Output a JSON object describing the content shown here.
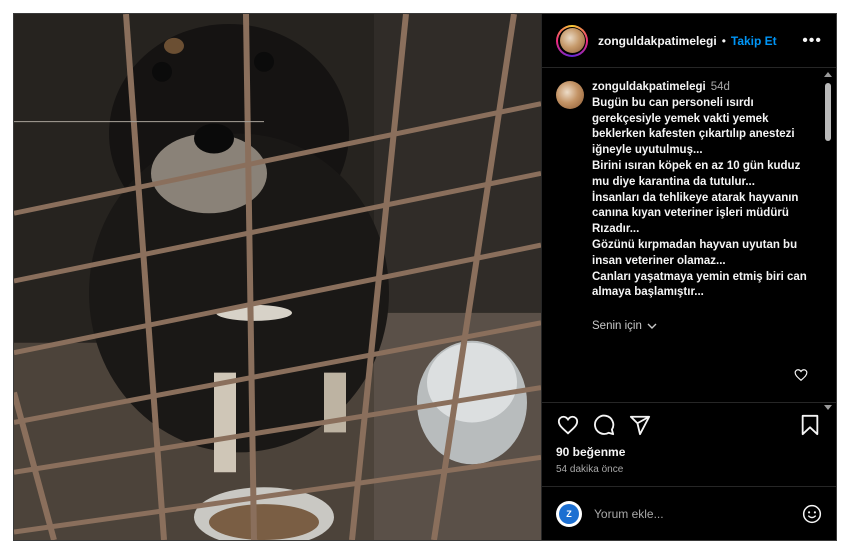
{
  "post": {
    "photo_alt": "",
    "header": {
      "username": "zonguldakpatimelegi",
      "separator": "•",
      "follow_label": "Takip Et",
      "more_label": "•••"
    },
    "caption": {
      "username": "zonguldakpatimelegi",
      "time": "54d",
      "lines": [
        "Bugün bu can personeli ısırdı",
        "gerekçesiyle yemek vakti yemek",
        "beklerken kafesten çıkartılıp anestezi",
        "iğneyle uyutulmuş...",
        "Birini ısıran köpek en az 10 gün kuduz",
        "mu diye karantina da tutulur...",
        "İnsanları da tehlikeye atarak hayvanın",
        "canına kıyan veteriner işleri müdürü",
        "Rızadır...",
        "Gözünü kırpmadan hayvan uyutan bu",
        "insan veteriner olamaz...",
        "Canları yaşatmaya yemin etmiş biri can",
        "almaya başlamıştır..."
      ],
      "translation_label": "Senin için"
    },
    "engagement": {
      "likes": "90 beğenme",
      "time_ago": "54 dakika önce"
    },
    "comment": {
      "placeholder": "Yorum ekle...",
      "avatar_label": "Z"
    }
  },
  "colors": {
    "accent": "#0095f6",
    "background": "#000000",
    "text": "#f5f5f5",
    "muted": "#a8a8a8"
  }
}
